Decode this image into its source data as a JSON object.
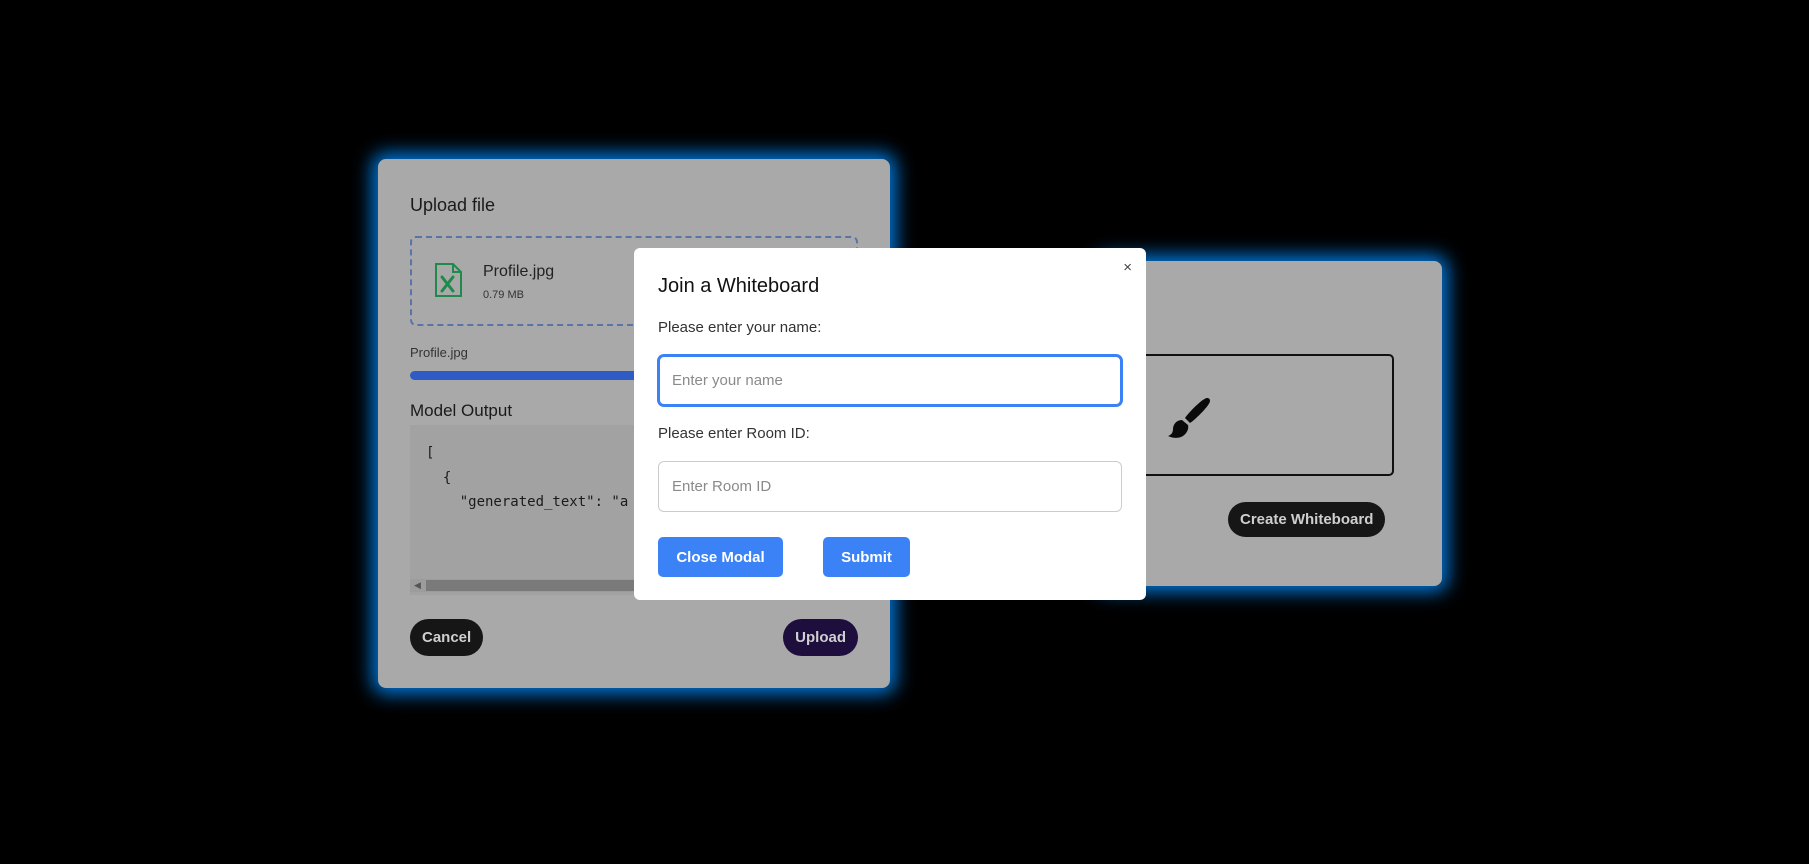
{
  "colors": {
    "background": "#000000",
    "glow": "#008cff",
    "primary_button": "#3b82f6",
    "progress": "#2f5bc4",
    "file_icon": "#1f8a4c"
  },
  "upload_card": {
    "title": "Upload file",
    "file": {
      "icon": "excel-file-icon",
      "name": "Profile.jpg",
      "size": "0.79 MB"
    },
    "progress": {
      "label": "Profile.jpg",
      "percent": 100
    },
    "model_output": {
      "title": "Model Output",
      "code": "[\n  {\n    \"generated_text\": \"a"
    },
    "cancel_label": "Cancel",
    "upload_label": "Upload"
  },
  "whiteboard_card": {
    "canvas_icon": "paintbrush-icon",
    "create_label": "Create Whiteboard"
  },
  "modal": {
    "close_symbol": "×",
    "title": "Join a Whiteboard",
    "name_label": "Please enter your name:",
    "name_placeholder": "Enter your name",
    "name_value": "",
    "room_label": "Please enter Room ID:",
    "room_placeholder": "Enter Room ID",
    "room_value": "",
    "close_modal_label": "Close Modal",
    "submit_label": "Submit"
  }
}
